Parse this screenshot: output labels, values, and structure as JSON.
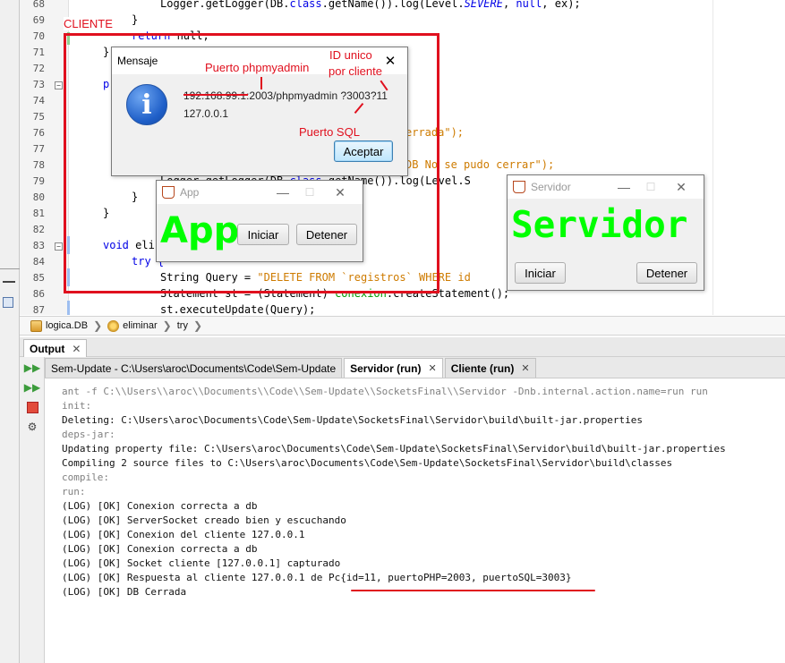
{
  "editor": {
    "line_numbers": [
      "68",
      "69",
      "70",
      "71",
      "72",
      "73",
      "74",
      "75",
      "76",
      "77",
      "78",
      "79",
      "80",
      "81",
      "82",
      "83",
      "84",
      "85",
      "86",
      "87"
    ],
    "code": {
      "l68_a": "Logger.getLogger(DB.",
      "l68_b": "class",
      "l68_c": ".getName()).log(Level.",
      "l68_d": "SEVERE",
      "l68_e": ", ",
      "l68_f": "null",
      "l68_g": ", ex);",
      "l69": "}",
      "l70_a": "return",
      "l70_b": " null;",
      "l71": "}",
      "l73": "p",
      "l76": "errada\");",
      "l78": "DB No se pudo cerrar\");",
      "l79_a": "Logger.getLogger(DB.",
      "l79_b": "class",
      "l79_c": ".getName()).log(Level.S",
      "l80": "}",
      "l81": "}",
      "l83_a": "void",
      "l83_b": " eli",
      "l84": "try {",
      "l85_a": "String Query = ",
      "l85_b": "\"DELETE FROM `registros` WHERE id",
      "l86_a": "Statement st = (Statement) ",
      "l86_b": "conexion",
      "l86_c": ".createStatement();",
      "l87": "st.executeUpdate(Query);"
    }
  },
  "breadcrumb": {
    "items": [
      "logica.DB",
      "eliminar",
      "try"
    ]
  },
  "output": {
    "tab_label": "Output",
    "subtabs": [
      {
        "label": "Sem-Update - C:\\Users\\aroc\\Documents\\Code\\Sem-Update",
        "active": false,
        "closable": false
      },
      {
        "label": "Servidor (run)",
        "active": true,
        "closable": true
      },
      {
        "label": "Cliente (run)",
        "active": false,
        "closable": true
      }
    ],
    "lines": [
      {
        "text": "ant -f C:\\\\Users\\\\aroc\\\\Documents\\\\Code\\\\Sem-Update\\\\SocketsFinal\\\\Servidor -Dnb.internal.action.name=run run",
        "gray": true
      },
      {
        "text": "init:",
        "gray": true
      },
      {
        "text": "Deleting: C:\\Users\\aroc\\Documents\\Code\\Sem-Update\\SocketsFinal\\Servidor\\build\\built-jar.properties",
        "gray": false
      },
      {
        "text": "deps-jar:",
        "gray": true
      },
      {
        "text": "Updating property file: C:\\Users\\aroc\\Documents\\Code\\Sem-Update\\SocketsFinal\\Servidor\\build\\built-jar.properties",
        "gray": false
      },
      {
        "text": "Compiling 2 source files to C:\\Users\\aroc\\Documents\\Code\\Sem-Update\\SocketsFinal\\Servidor\\build\\classes",
        "gray": false
      },
      {
        "text": "compile:",
        "gray": true
      },
      {
        "text": "run:",
        "gray": true
      },
      {
        "text": "(LOG) [OK] Conexion correcta a db",
        "gray": false
      },
      {
        "text": "(LOG) [OK] ServerSocket creado bien y escuchando",
        "gray": false
      },
      {
        "text": "(LOG) [OK] Conexion del cliente 127.0.0.1",
        "gray": false
      },
      {
        "text": "(LOG) [OK] Conexion correcta a db",
        "gray": false
      },
      {
        "text": "(LOG) [OK] Socket cliente [127.0.0.1] capturado",
        "gray": false
      },
      {
        "text": "(LOG) [OK] Respuesta al cliente 127.0.0.1 de Pc{id=11, puertoPHP=2003, puertoSQL=3003}",
        "gray": false
      },
      {
        "text": "(LOG) [OK] DB Cerrada",
        "gray": false
      }
    ]
  },
  "mensaje_dialog": {
    "title": "Mensaje",
    "line1": "192.168.99.1:2003/phpmyadmin ?3003?11",
    "line2": "127.0.0.1",
    "ok_label": "Aceptar",
    "close_glyph": "✕"
  },
  "app_window": {
    "title": "App",
    "big_label": "App",
    "start_label": "Iniciar",
    "stop_label": "Detener"
  },
  "server_window": {
    "title": "Servidor",
    "big_label": "Servidor",
    "start_label": "Iniciar",
    "stop_label": "Detener"
  },
  "annotations": {
    "cliente": "CLIENTE",
    "puerto_phpmyadmin": "Puerto phpmyadmin",
    "id_unico_1": "ID unico",
    "id_unico_2": "por cliente",
    "puerto_sql": "Puerto SQL"
  },
  "colors": {
    "annotation_red": "#e0101e",
    "big_label_green": "#00ff00",
    "keyword_blue": "#0000e6",
    "string_orange": "#ce7b00"
  }
}
